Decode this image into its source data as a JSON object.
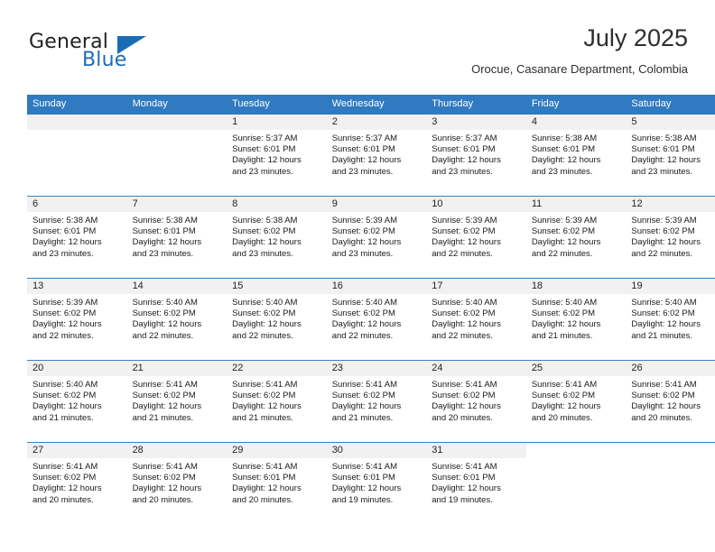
{
  "brand": {
    "name_part1": "General",
    "name_part2": "Blue",
    "triangle_icon": "triangle-icon",
    "accent_color": "#1c6cb5"
  },
  "header": {
    "title": "July 2025",
    "subtitle": "Orocue, Casanare Department, Colombia"
  },
  "calendar": {
    "header_bg": "#2f7ac0",
    "daynum_bg": "#f1f1f1",
    "separator_color": "#3f7fbf",
    "weekday_headers": [
      "Sunday",
      "Monday",
      "Tuesday",
      "Wednesday",
      "Thursday",
      "Friday",
      "Saturday"
    ],
    "weeks": [
      [
        {
          "day": "",
          "lines": []
        },
        {
          "day": "",
          "lines": []
        },
        {
          "day": "1",
          "lines": [
            "Sunrise: 5:37 AM",
            "Sunset: 6:01 PM",
            "Daylight: 12 hours",
            "and 23 minutes."
          ]
        },
        {
          "day": "2",
          "lines": [
            "Sunrise: 5:37 AM",
            "Sunset: 6:01 PM",
            "Daylight: 12 hours",
            "and 23 minutes."
          ]
        },
        {
          "day": "3",
          "lines": [
            "Sunrise: 5:37 AM",
            "Sunset: 6:01 PM",
            "Daylight: 12 hours",
            "and 23 minutes."
          ]
        },
        {
          "day": "4",
          "lines": [
            "Sunrise: 5:38 AM",
            "Sunset: 6:01 PM",
            "Daylight: 12 hours",
            "and 23 minutes."
          ]
        },
        {
          "day": "5",
          "lines": [
            "Sunrise: 5:38 AM",
            "Sunset: 6:01 PM",
            "Daylight: 12 hours",
            "and 23 minutes."
          ]
        }
      ],
      [
        {
          "day": "6",
          "lines": [
            "Sunrise: 5:38 AM",
            "Sunset: 6:01 PM",
            "Daylight: 12 hours",
            "and 23 minutes."
          ]
        },
        {
          "day": "7",
          "lines": [
            "Sunrise: 5:38 AM",
            "Sunset: 6:01 PM",
            "Daylight: 12 hours",
            "and 23 minutes."
          ]
        },
        {
          "day": "8",
          "lines": [
            "Sunrise: 5:38 AM",
            "Sunset: 6:02 PM",
            "Daylight: 12 hours",
            "and 23 minutes."
          ]
        },
        {
          "day": "9",
          "lines": [
            "Sunrise: 5:39 AM",
            "Sunset: 6:02 PM",
            "Daylight: 12 hours",
            "and 23 minutes."
          ]
        },
        {
          "day": "10",
          "lines": [
            "Sunrise: 5:39 AM",
            "Sunset: 6:02 PM",
            "Daylight: 12 hours",
            "and 22 minutes."
          ]
        },
        {
          "day": "11",
          "lines": [
            "Sunrise: 5:39 AM",
            "Sunset: 6:02 PM",
            "Daylight: 12 hours",
            "and 22 minutes."
          ]
        },
        {
          "day": "12",
          "lines": [
            "Sunrise: 5:39 AM",
            "Sunset: 6:02 PM",
            "Daylight: 12 hours",
            "and 22 minutes."
          ]
        }
      ],
      [
        {
          "day": "13",
          "lines": [
            "Sunrise: 5:39 AM",
            "Sunset: 6:02 PM",
            "Daylight: 12 hours",
            "and 22 minutes."
          ]
        },
        {
          "day": "14",
          "lines": [
            "Sunrise: 5:40 AM",
            "Sunset: 6:02 PM",
            "Daylight: 12 hours",
            "and 22 minutes."
          ]
        },
        {
          "day": "15",
          "lines": [
            "Sunrise: 5:40 AM",
            "Sunset: 6:02 PM",
            "Daylight: 12 hours",
            "and 22 minutes."
          ]
        },
        {
          "day": "16",
          "lines": [
            "Sunrise: 5:40 AM",
            "Sunset: 6:02 PM",
            "Daylight: 12 hours",
            "and 22 minutes."
          ]
        },
        {
          "day": "17",
          "lines": [
            "Sunrise: 5:40 AM",
            "Sunset: 6:02 PM",
            "Daylight: 12 hours",
            "and 22 minutes."
          ]
        },
        {
          "day": "18",
          "lines": [
            "Sunrise: 5:40 AM",
            "Sunset: 6:02 PM",
            "Daylight: 12 hours",
            "and 21 minutes."
          ]
        },
        {
          "day": "19",
          "lines": [
            "Sunrise: 5:40 AM",
            "Sunset: 6:02 PM",
            "Daylight: 12 hours",
            "and 21 minutes."
          ]
        }
      ],
      [
        {
          "day": "20",
          "lines": [
            "Sunrise: 5:40 AM",
            "Sunset: 6:02 PM",
            "Daylight: 12 hours",
            "and 21 minutes."
          ]
        },
        {
          "day": "21",
          "lines": [
            "Sunrise: 5:41 AM",
            "Sunset: 6:02 PM",
            "Daylight: 12 hours",
            "and 21 minutes."
          ]
        },
        {
          "day": "22",
          "lines": [
            "Sunrise: 5:41 AM",
            "Sunset: 6:02 PM",
            "Daylight: 12 hours",
            "and 21 minutes."
          ]
        },
        {
          "day": "23",
          "lines": [
            "Sunrise: 5:41 AM",
            "Sunset: 6:02 PM",
            "Daylight: 12 hours",
            "and 21 minutes."
          ]
        },
        {
          "day": "24",
          "lines": [
            "Sunrise: 5:41 AM",
            "Sunset: 6:02 PM",
            "Daylight: 12 hours",
            "and 20 minutes."
          ]
        },
        {
          "day": "25",
          "lines": [
            "Sunrise: 5:41 AM",
            "Sunset: 6:02 PM",
            "Daylight: 12 hours",
            "and 20 minutes."
          ]
        },
        {
          "day": "26",
          "lines": [
            "Sunrise: 5:41 AM",
            "Sunset: 6:02 PM",
            "Daylight: 12 hours",
            "and 20 minutes."
          ]
        }
      ],
      [
        {
          "day": "27",
          "lines": [
            "Sunrise: 5:41 AM",
            "Sunset: 6:02 PM",
            "Daylight: 12 hours",
            "and 20 minutes."
          ]
        },
        {
          "day": "28",
          "lines": [
            "Sunrise: 5:41 AM",
            "Sunset: 6:02 PM",
            "Daylight: 12 hours",
            "and 20 minutes."
          ]
        },
        {
          "day": "29",
          "lines": [
            "Sunrise: 5:41 AM",
            "Sunset: 6:01 PM",
            "Daylight: 12 hours",
            "and 20 minutes."
          ]
        },
        {
          "day": "30",
          "lines": [
            "Sunrise: 5:41 AM",
            "Sunset: 6:01 PM",
            "Daylight: 12 hours",
            "and 19 minutes."
          ]
        },
        {
          "day": "31",
          "lines": [
            "Sunrise: 5:41 AM",
            "Sunset: 6:01 PM",
            "Daylight: 12 hours",
            "and 19 minutes."
          ]
        },
        {
          "day": "",
          "lines": []
        },
        {
          "day": "",
          "lines": []
        }
      ]
    ]
  }
}
